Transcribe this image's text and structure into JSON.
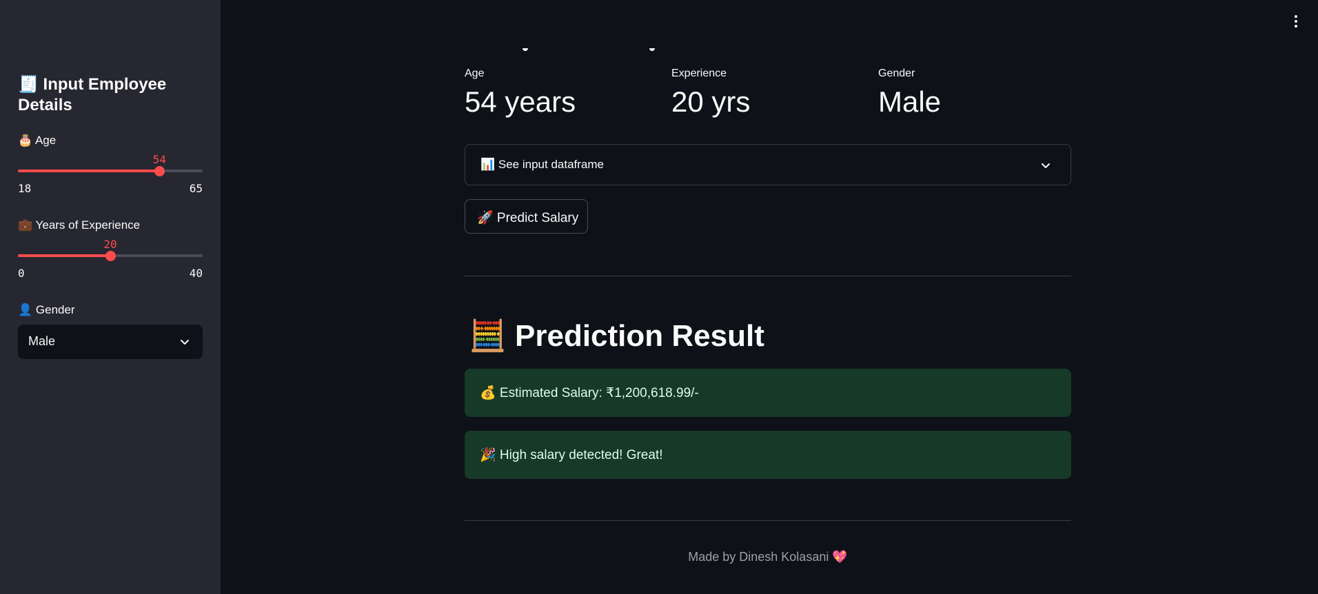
{
  "sidebar": {
    "title": "🧾 Input Employee Details",
    "age": {
      "label": "🎂 Age",
      "value": 54,
      "min": 18,
      "max": 65
    },
    "experience": {
      "label": "💼 Years of Experience",
      "value": 20,
      "min": 0,
      "max": 40
    },
    "gender": {
      "label": "👤 Gender",
      "selected": "Male"
    }
  },
  "metrics": [
    {
      "label": "Age",
      "value": "54 years"
    },
    {
      "label": "Experience",
      "value": "20 yrs"
    },
    {
      "label": "Gender",
      "value": "Male"
    }
  ],
  "expander": {
    "label": "📊 See input dataframe"
  },
  "predict_button": {
    "label": "🚀 Predict Salary"
  },
  "result": {
    "title": "🧮 Prediction Result",
    "salary_text": "💰 Estimated Salary: ₹1,200,618.99/-",
    "message_text": "🎉 High salary detected! Great!"
  },
  "footer": {
    "text": "Made by Dinesh Kolasani",
    "heart": "💖"
  },
  "colors": {
    "accent": "#ff4b4b",
    "sidebar_bg": "#262730",
    "main_bg": "#0e1117",
    "success_bg": "#173928"
  },
  "icons": [
    "chevron-down-icon",
    "more-vert-icon"
  ]
}
